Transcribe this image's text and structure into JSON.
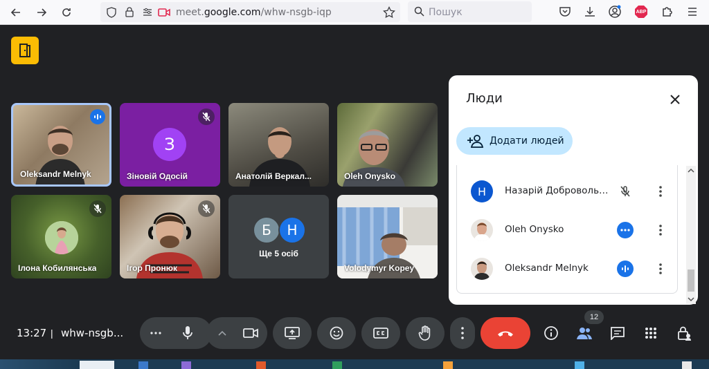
{
  "browser": {
    "url_prefix": "meet.",
    "url_domain": "google.com",
    "url_path": "/whw-nsgb-iqp",
    "search_placeholder": "Пошук",
    "abp_label": "ABP"
  },
  "tiles": [
    {
      "name": "Oleksandr Melnyk",
      "status": "speaking"
    },
    {
      "name": "Зіновій Одосій",
      "initial": "З",
      "status": "muted"
    },
    {
      "name": "Анатолій Веркал...",
      "status": "none"
    },
    {
      "name": "Oleh Onysko",
      "status": "none"
    },
    {
      "name": "Ілона Кобилянська",
      "status": "muted"
    },
    {
      "name": "Ігор Пронюк",
      "status": "muted"
    },
    {
      "name": "Ще 5 осіб",
      "initials": [
        "Б",
        "Н"
      ]
    },
    {
      "name": "Volodymyr Kopey",
      "status": "none"
    }
  ],
  "panel": {
    "title": "Люди",
    "add_label": "Додати людей",
    "people": [
      {
        "name": "Назарій Добровольсь...",
        "initial": "Н",
        "status": "muted"
      },
      {
        "name": "Oleh Onysko",
        "status": "active"
      },
      {
        "name": "Oleksandr Melnyk",
        "status": "speaking"
      }
    ]
  },
  "bottom": {
    "time": "13:27",
    "separator": "|",
    "meeting_code": "whw-nsgb...",
    "people_count": "12"
  },
  "colors": {
    "accent_blue": "#1a73e8",
    "end_call_red": "#ea4335",
    "logo_yellow": "#fbbc04"
  }
}
